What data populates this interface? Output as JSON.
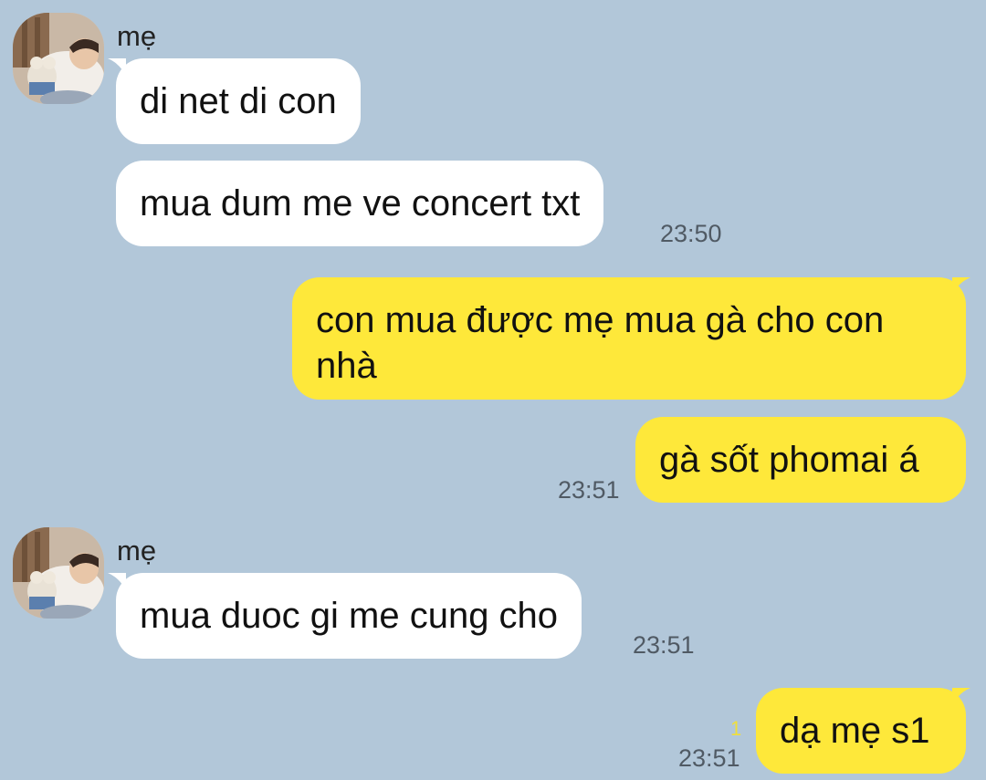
{
  "colors": {
    "background": "#b2c7d9",
    "incoming_bubble": "#ffffff",
    "outgoing_bubble": "#fee83a",
    "timestamp": "#505a64",
    "unread_count": "#f0df3a"
  },
  "messages": [
    {
      "direction": "incoming",
      "sender": "mẹ",
      "avatar_icon": "sleeping-child-photo-icon",
      "text": "di net di con",
      "time": ""
    },
    {
      "direction": "incoming",
      "sender": "",
      "text": "mua dum me ve concert txt",
      "time": "23:50"
    },
    {
      "direction": "outgoing",
      "text": "con mua được mẹ mua gà cho con nhà",
      "time": ""
    },
    {
      "direction": "outgoing",
      "text": "gà sốt phomai á",
      "time": "23:51"
    },
    {
      "direction": "incoming",
      "sender": "mẹ",
      "avatar_icon": "sleeping-child-photo-icon",
      "text": "mua duoc gi me cung cho",
      "time": "23:51"
    },
    {
      "direction": "outgoing",
      "text": "dạ mẹ s1",
      "time": "23:51",
      "unread": "1"
    }
  ]
}
